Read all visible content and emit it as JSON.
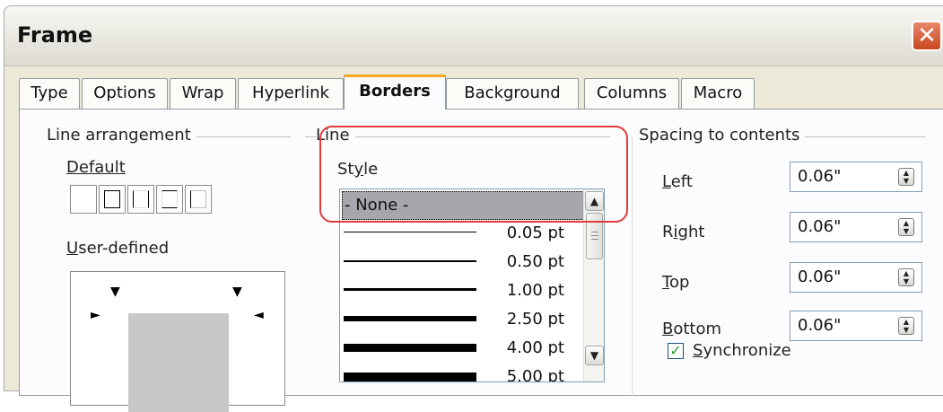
{
  "window": {
    "title": "Frame",
    "close_glyph": "✕"
  },
  "tabs": [
    {
      "label": "Type"
    },
    {
      "label": "Options"
    },
    {
      "label": "Wrap"
    },
    {
      "label": "Hyperlink"
    },
    {
      "label": "Borders"
    },
    {
      "label": "Background"
    },
    {
      "label": "Columns"
    },
    {
      "label": "Macro"
    }
  ],
  "active_tab": "Borders",
  "line_arrangement": {
    "group_label": "Line arrangement",
    "default_label": "Default",
    "user_defined_label": "User-defined"
  },
  "line": {
    "group_label": "Line",
    "style_label": "Style",
    "selected": "- None -",
    "styles": [
      "0.05 pt",
      "0.50 pt",
      "1.00 pt",
      "2.50 pt",
      "4.00 pt",
      "5.00 pt"
    ]
  },
  "spacing": {
    "group_label": "Spacing to contents",
    "left_label": "Left",
    "left_value": "0.06\"",
    "right_label": "Right",
    "right_value": "0.06\"",
    "top_label": "Top",
    "top_value": "0.06\"",
    "bottom_label": "Bottom",
    "bottom_value": "0.06\"",
    "synchronize_label": "Synchronize",
    "synchronize_checked": true
  },
  "colors": {
    "highlight": "#e23b3b",
    "active_tab_accent": "#f5a623",
    "check": "#21a121"
  },
  "icons": {
    "close": "close-icon",
    "scroll_up": "chevron-up-icon",
    "scroll_down": "chevron-down-icon",
    "spin": "spin-arrows-icon",
    "check": "checkmark-icon"
  }
}
